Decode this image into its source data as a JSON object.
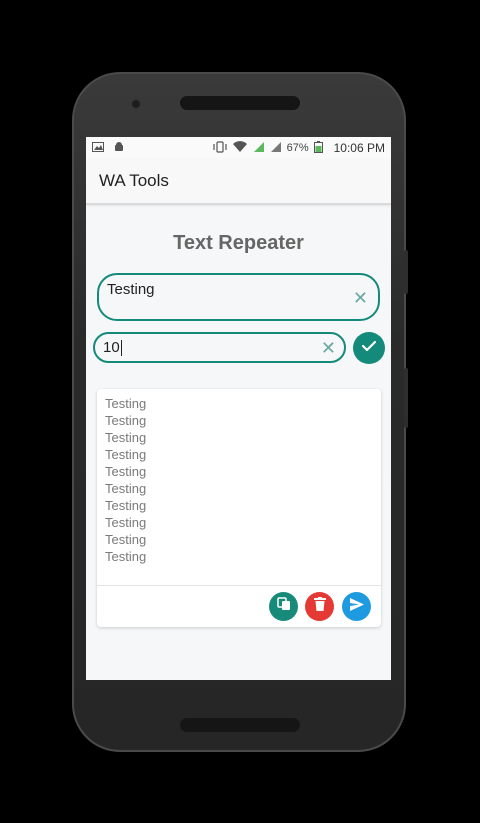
{
  "status_bar": {
    "battery": "67%",
    "time": "10:06 PM",
    "left_icons": [
      "image-icon",
      "android-icon"
    ],
    "right_icons": [
      "vibrate-icon",
      "wifi-icon",
      "signal-1-icon",
      "signal-2-icon",
      "battery-icon"
    ]
  },
  "app_bar": {
    "title": "WA Tools"
  },
  "main": {
    "heading": "Text Repeater",
    "text_input": {
      "value": "Testing"
    },
    "count_input": {
      "value": "10"
    },
    "output": {
      "lines": [
        "Testing",
        "Testing",
        "Testing",
        "Testing",
        "Testing",
        "Testing",
        "Testing",
        "Testing",
        "Testing",
        "Testing"
      ]
    }
  },
  "colors": {
    "accent": "#148a7a",
    "delete": "#e53935",
    "send": "#1e9be0"
  }
}
